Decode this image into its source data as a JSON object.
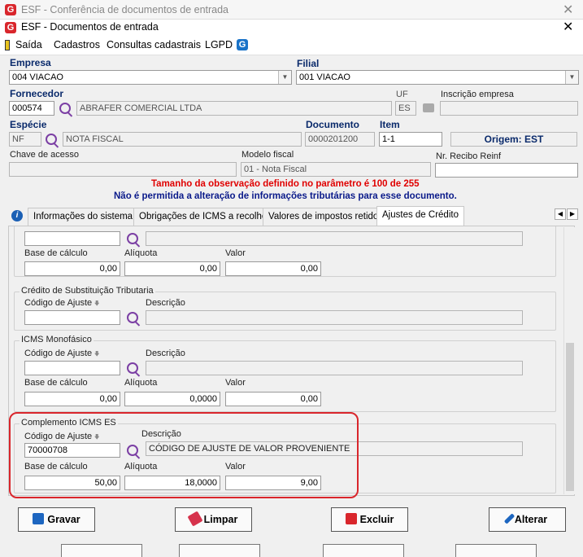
{
  "outer_window": {
    "title": "ESF - Conferência de documentos de entrada"
  },
  "window": {
    "title": "ESF - Documentos de entrada"
  },
  "menu": [
    "Saída",
    "Cadastros",
    "Consultas cadastrais",
    "LGPD"
  ],
  "logo_letter": "G",
  "header": {
    "empresa": {
      "label": "Empresa",
      "value": "004 VIACAO"
    },
    "filial": {
      "label": "Filial",
      "value": "001 VIACAO"
    },
    "fornecedor": {
      "label": "Fornecedor",
      "code": "000574",
      "name": "ABRAFER COMERCIAL LTDA"
    },
    "uf": {
      "label": "UF",
      "value": "ES"
    },
    "inscricao": {
      "label": "Inscrição empresa",
      "value": ""
    },
    "especie": {
      "label": "Espécie",
      "code": "NF",
      "name": "NOTA FISCAL"
    },
    "documento": {
      "label": "Documento",
      "value": "0000201200"
    },
    "item": {
      "label": "Item",
      "value": "1-1"
    },
    "origem": "Origem: EST",
    "chave": {
      "label": "Chave de acesso",
      "value": ""
    },
    "modelo": {
      "label": "Modelo fiscal",
      "value": "01 - Nota Fiscal"
    },
    "recibo": {
      "label": "Nr. Recibo Reinf",
      "value": ""
    }
  },
  "messages": {
    "warning_red": "Tamanho da observação definido no parâmetro é 100 de 255",
    "warning_blue": "Não é permitida a alteração de informações tributárias para esse documento."
  },
  "tabs": [
    "Informações do sistema",
    "Obrigações de ICMS a recolher",
    "Valores de impostos retidos",
    "Ajustes de Crédito"
  ],
  "labels": {
    "codigo_ajuste": "Código de Ajuste",
    "descricao": "Descrição",
    "base_calculo": "Base de cálculo",
    "aliquota": "Alíquota",
    "valor": "Valor"
  },
  "section_top": {
    "base": "0,00",
    "aliquota": "0,00",
    "valor": "0,00"
  },
  "section_st": {
    "title": "Crédito de Substituição Tributaria",
    "codigo": "",
    "descricao": ""
  },
  "section_mono": {
    "title": "ICMS Monofásico",
    "codigo": "",
    "descricao": "",
    "base": "0,00",
    "aliquota": "0,0000",
    "valor": "0,00"
  },
  "section_comp": {
    "title": "Complemento ICMS ES",
    "codigo": "70000708",
    "descricao": "CÓDIGO DE AJUSTE DE VALOR PROVENIENTE",
    "base": "50,00",
    "aliquota": "18,0000",
    "valor": "9,00"
  },
  "buttons": {
    "gravar": "Gravar",
    "limpar": "Limpar",
    "excluir": "Excluir",
    "alterar": "Alterar"
  },
  "colors": {
    "highlight": "#d9262c",
    "warning_red": "#e00000",
    "warning_blue": "#0a1a8a",
    "label_blue": "#0a2a6b"
  }
}
